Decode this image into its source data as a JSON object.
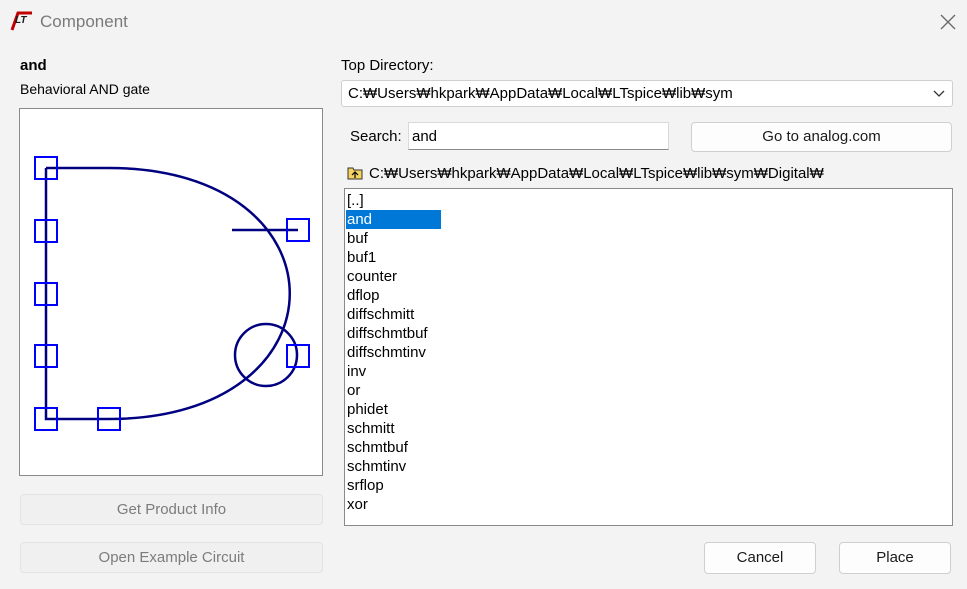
{
  "window": {
    "title": "Component"
  },
  "component": {
    "name": "and",
    "description": "Behavioral AND gate"
  },
  "buttons": {
    "product_info": "Get Product Info",
    "open_example": "Open Example Circuit",
    "analog": "Go to analog.com",
    "cancel": "Cancel",
    "place": "Place"
  },
  "top_directory": {
    "label": "Top Directory:",
    "value": "C:₩Users₩hkpark₩AppData₩Local₩LTspice₩lib₩sym"
  },
  "search": {
    "label": "Search:",
    "value": "and"
  },
  "current_path": "C:₩Users₩hkpark₩AppData₩Local₩LTspice₩lib₩sym₩Digital₩",
  "list": {
    "selected": "and",
    "items": [
      "[..]",
      "and",
      "buf",
      "buf1",
      "counter",
      "dflop",
      "diffschmitt",
      "diffschmtbuf",
      "diffschmtinv",
      "inv",
      "or",
      "phidet",
      "schmitt",
      "schmtbuf",
      "schmtinv",
      "srflop",
      "xor"
    ]
  },
  "colors": {
    "selection": "#0078d7",
    "symbol_line": "#000080",
    "pin": "#0000ff"
  }
}
